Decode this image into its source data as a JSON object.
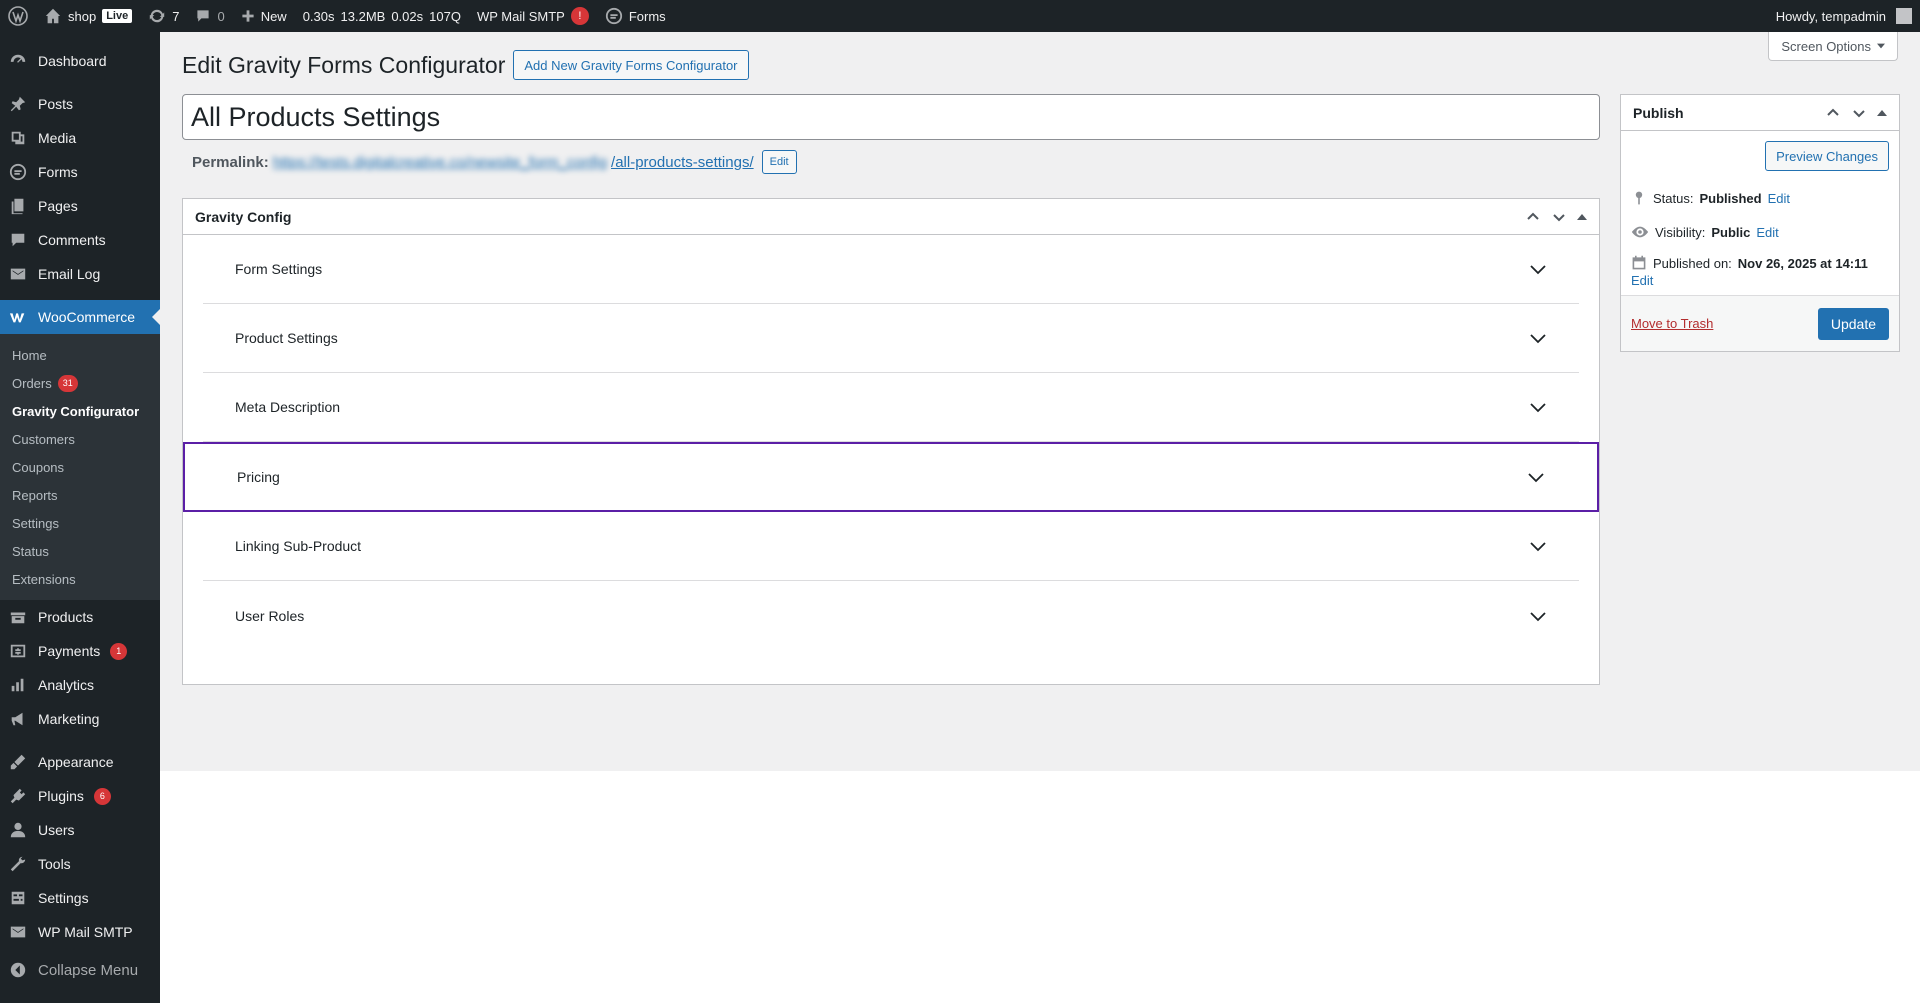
{
  "adminbar": {
    "site_name": "shop",
    "live_label": "Live",
    "updates_count": "7",
    "comments_count": "0",
    "new_label": "New",
    "perf_time": "0.30s",
    "perf_mem": "13.2MB",
    "perf_db_time": "0.02s",
    "perf_queries": "107Q",
    "smtp_label": "WP Mail SMTP",
    "smtp_alert": "!",
    "forms_label": "Forms",
    "greeting": "Howdy, tempadmin"
  },
  "sidebar": {
    "top_items": [
      {
        "label": "Dashboard",
        "icon": "dashboard-icon"
      },
      {
        "label": "Posts",
        "icon": "pin-icon"
      },
      {
        "label": "Media",
        "icon": "media-icon"
      },
      {
        "label": "Forms",
        "icon": "forms-icon"
      },
      {
        "label": "Pages",
        "icon": "pages-icon"
      },
      {
        "label": "Comments",
        "icon": "comment-icon"
      },
      {
        "label": "Email Log",
        "icon": "email-icon"
      }
    ],
    "woocommerce_label": "WooCommerce",
    "woo_submenu": [
      {
        "label": "Home"
      },
      {
        "label": "Orders",
        "badge": "31"
      },
      {
        "label": "Gravity Configurator"
      },
      {
        "label": "Customers"
      },
      {
        "label": "Coupons"
      },
      {
        "label": "Reports"
      },
      {
        "label": "Settings"
      },
      {
        "label": "Status"
      },
      {
        "label": "Extensions"
      }
    ],
    "mid_items": [
      {
        "label": "Products",
        "icon": "products-icon"
      },
      {
        "label": "Payments",
        "icon": "payments-icon",
        "badge": "1"
      },
      {
        "label": "Analytics",
        "icon": "analytics-icon"
      },
      {
        "label": "Marketing",
        "icon": "marketing-icon"
      }
    ],
    "bottom_items": [
      {
        "label": "Appearance",
        "icon": "appearance-icon"
      },
      {
        "label": "Plugins",
        "icon": "plugins-icon",
        "badge": "6"
      },
      {
        "label": "Users",
        "icon": "users-icon"
      },
      {
        "label": "Tools",
        "icon": "tools-icon"
      },
      {
        "label": "Settings",
        "icon": "settings-icon"
      },
      {
        "label": "WP Mail SMTP",
        "icon": "mail-icon"
      }
    ],
    "collapse_label": "Collapse Menu"
  },
  "main": {
    "screen_options": "Screen Options",
    "page_title": "Edit Gravity Forms Configurator",
    "add_new_label": "Add New Gravity Forms Configurator",
    "post_title": "All Products Settings",
    "permalink_label": "Permalink:",
    "permalink_base": "https://tests.digitalcreative.co/newsite_form_config",
    "permalink_slug": "/all-products-settings/",
    "permalink_edit": "Edit"
  },
  "gravity_config": {
    "title": "Gravity Config",
    "sections": [
      {
        "label": "Form Settings"
      },
      {
        "label": "Product Settings"
      },
      {
        "label": "Meta Description"
      },
      {
        "label": "Pricing"
      },
      {
        "label": "Linking Sub-Product"
      },
      {
        "label": "User Roles"
      }
    ]
  },
  "publish": {
    "title": "Publish",
    "preview_label": "Preview Changes",
    "status_label": "Status:",
    "status_value": "Published",
    "visibility_label": "Visibility:",
    "visibility_value": "Public",
    "published_label": "Published on:",
    "published_value": "Nov 26, 2025 at 14:11",
    "edit_label": "Edit",
    "trash_label": "Move to Trash",
    "update_label": "Update"
  },
  "colors": {
    "admin_dark": "#1d2327",
    "accent": "#2271b1",
    "focus": "#5b1fa6",
    "alert": "#d63638"
  }
}
